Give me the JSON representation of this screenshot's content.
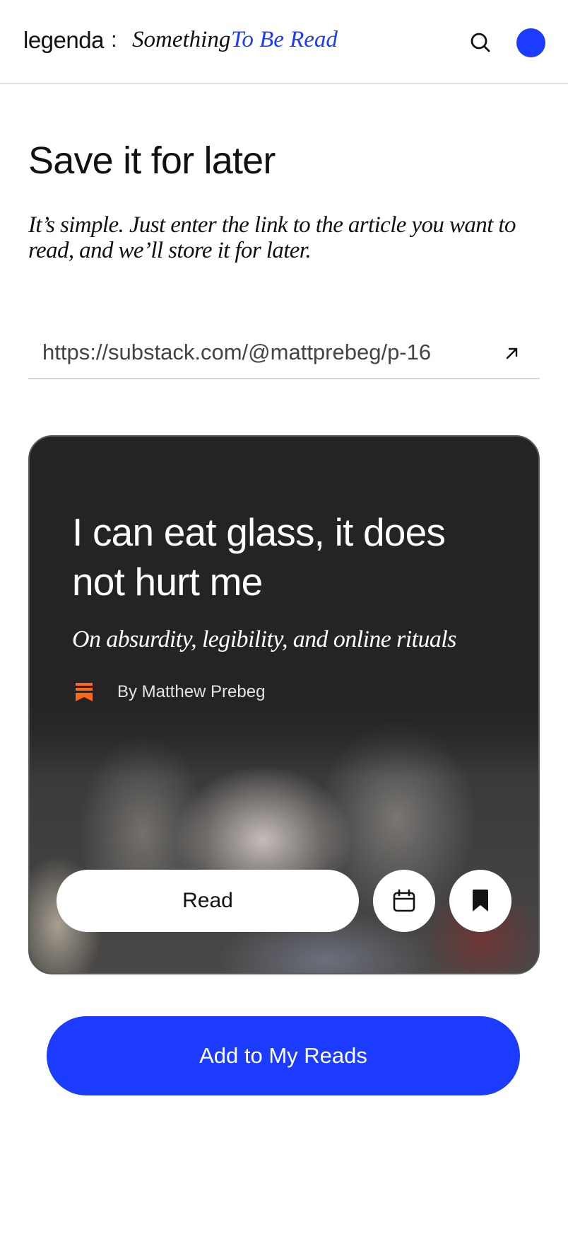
{
  "header": {
    "brand": "legenda",
    "separator": ":",
    "tagline_part1": "Something",
    "tagline_part2": "To Be Read"
  },
  "icons": {
    "search": "search-icon",
    "avatar": "avatar",
    "arrow": "arrow-up-right-icon",
    "publication": "substack-icon",
    "calendar": "calendar-icon",
    "bookmark": "bookmark-icon"
  },
  "hero": {
    "title": "Save it for later",
    "description": "It’s simple. Just enter the link to the article you want to read, and we’ll store it for later."
  },
  "url_input": {
    "value": "https://substack.com/@mattprebeg/p-16"
  },
  "article_card": {
    "title": "I can eat glass, it does not hurt me",
    "subtitle": "On absurdity, legibility, and online rituals",
    "byline": "By Matthew Prebeg",
    "read_label": "Read"
  },
  "cta": {
    "label": "Add to My Reads"
  },
  "colors": {
    "accent": "#1b3bff",
    "card_bg": "#242424",
    "substack_orange": "#ff6719"
  }
}
